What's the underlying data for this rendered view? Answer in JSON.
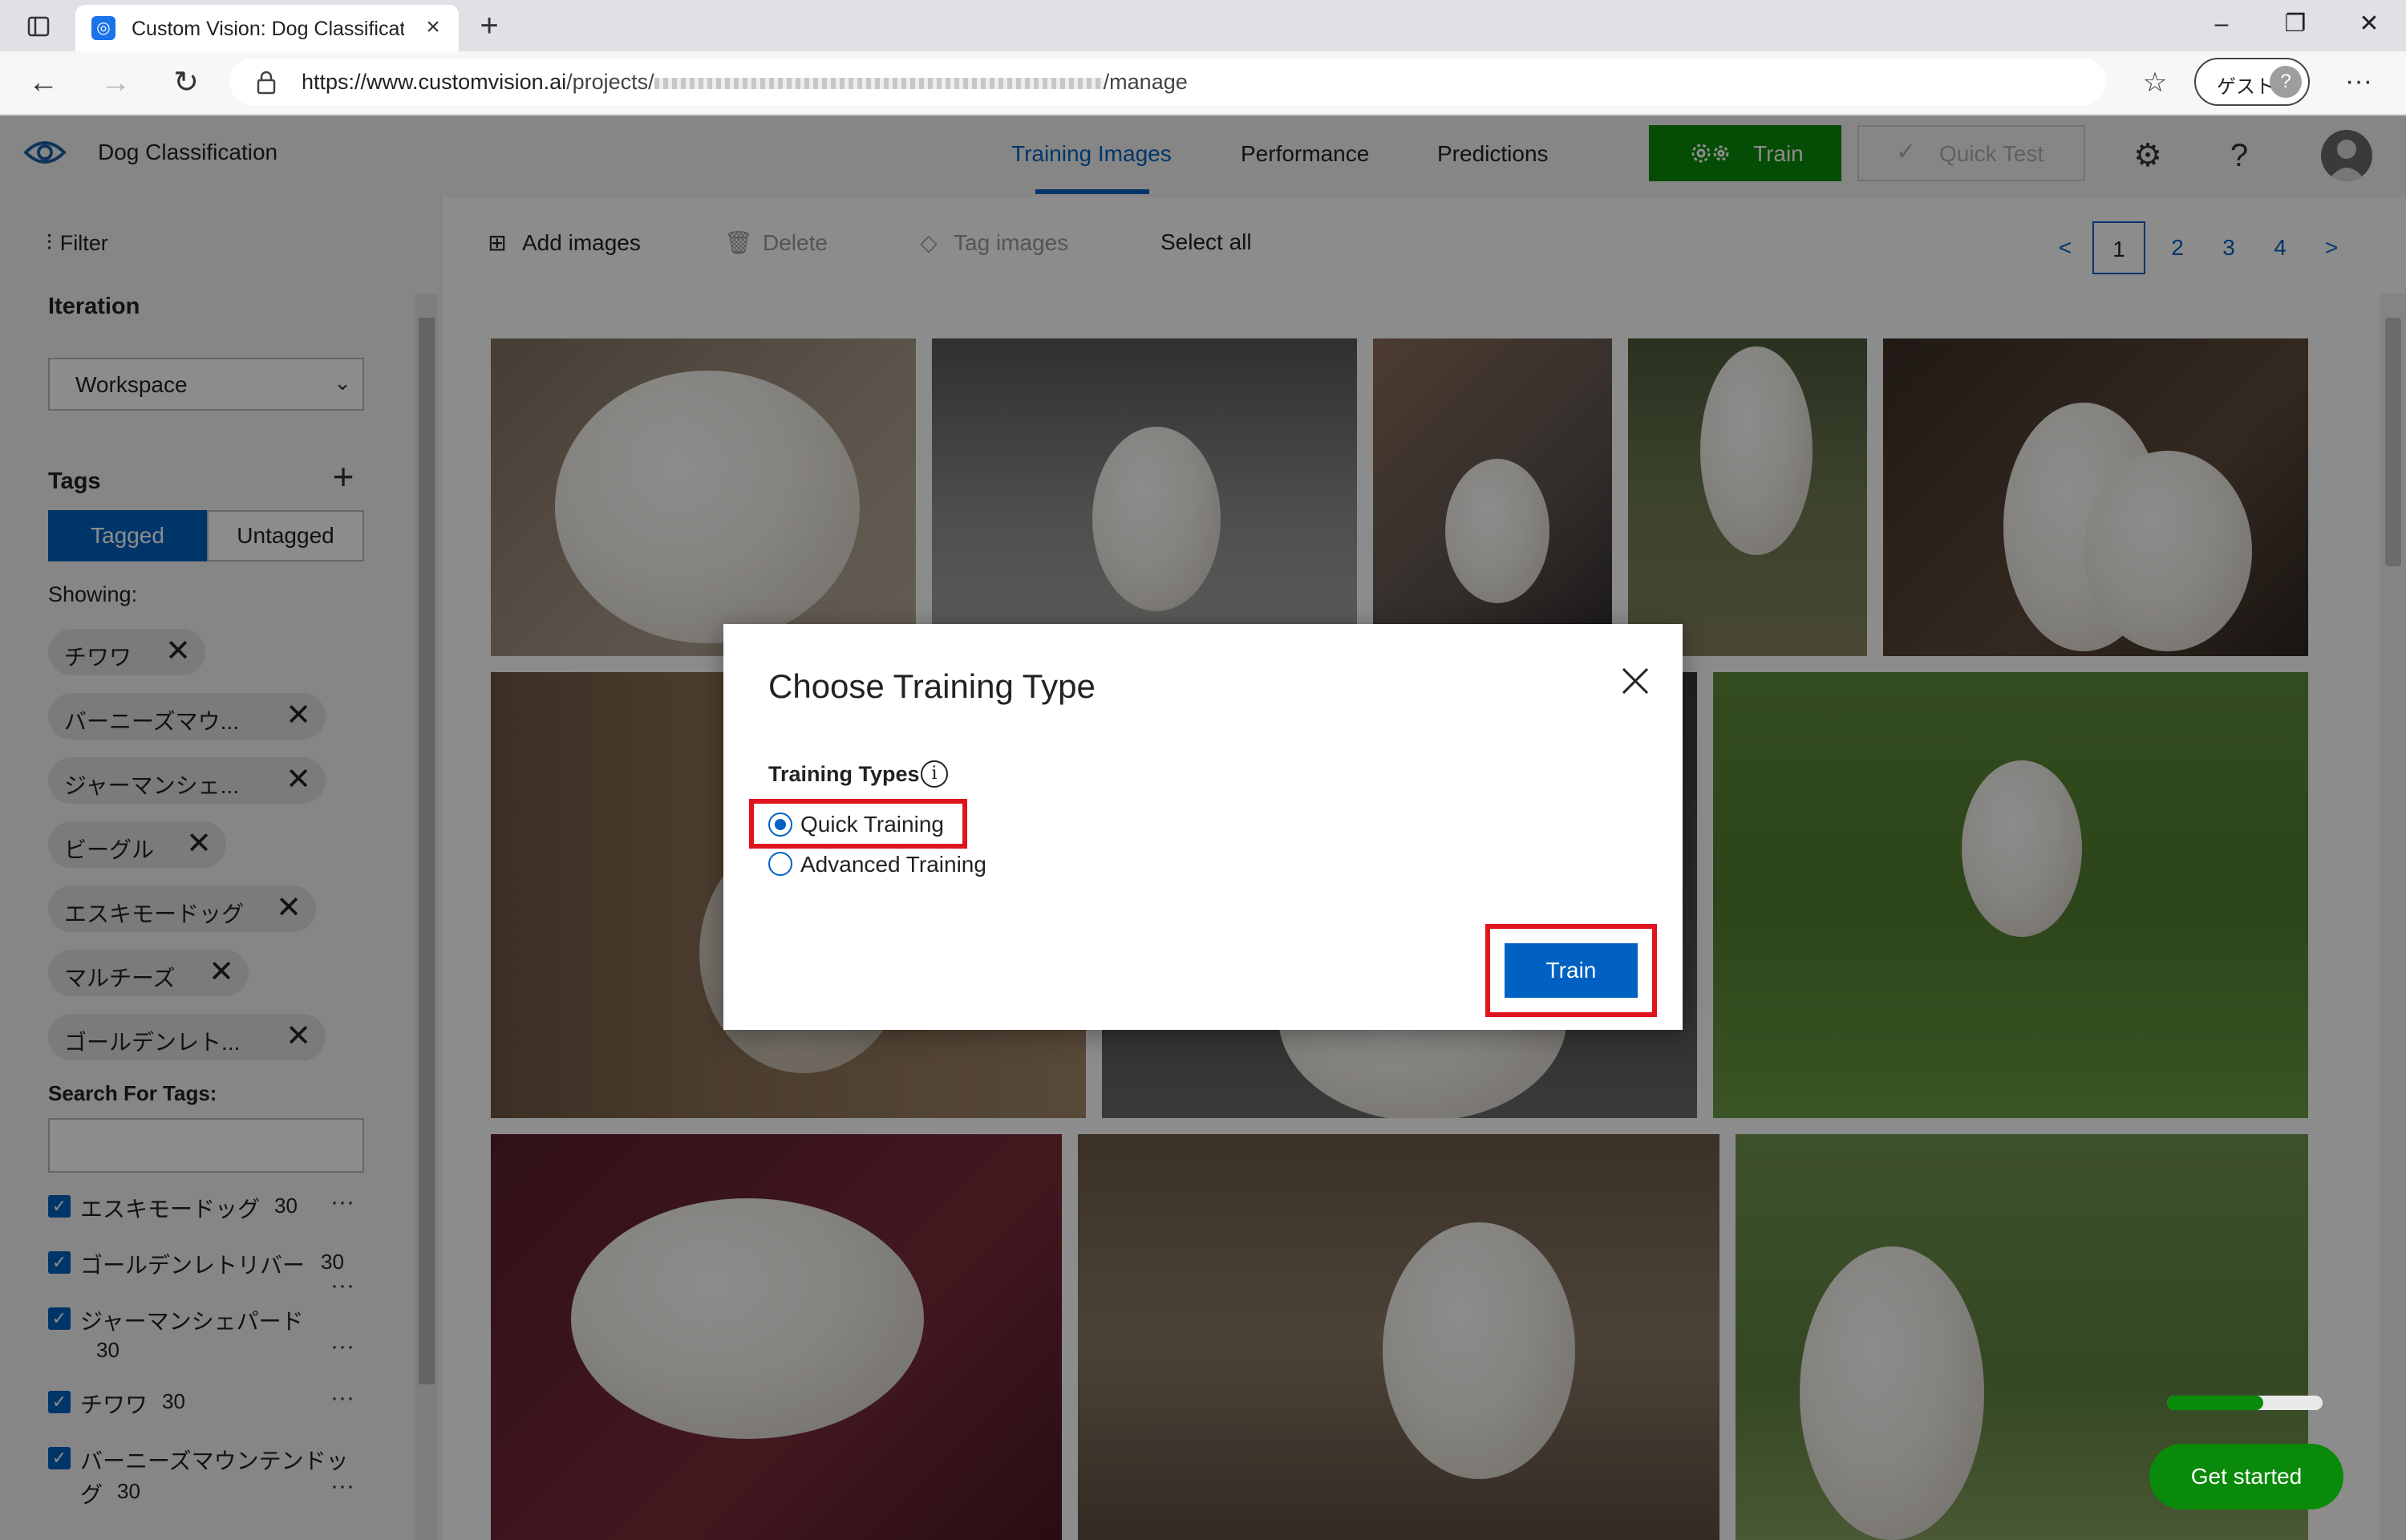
{
  "browser": {
    "tab_title": "Custom Vision: Dog Classificatio",
    "url_host": "https://www.customvision.ai",
    "url_path_start": "/projects/",
    "url_path_end": "/manage",
    "guest_label": "ゲスト"
  },
  "header": {
    "project_name": "Dog Classification",
    "tabs": [
      {
        "label": "Training Images",
        "active": true
      },
      {
        "label": "Performance",
        "active": false
      },
      {
        "label": "Predictions",
        "active": false
      }
    ],
    "train_label": "Train",
    "quick_test_label": "Quick Test"
  },
  "sidebar": {
    "filter_label": "Filter",
    "iteration_heading": "Iteration",
    "iteration_value": "Workspace",
    "tags_heading": "Tags",
    "tagged_label": "Tagged",
    "untagged_label": "Untagged",
    "showing_label": "Showing:",
    "chips": [
      "チワワ",
      "バーニーズマウ...",
      "ジャーマンシェ...",
      "ビーグル",
      "エスキモードッグ",
      "マルチーズ",
      "ゴールデンレト..."
    ],
    "search_label": "Search For Tags:",
    "tag_list": [
      {
        "name": "エスキモードッグ",
        "count": "30"
      },
      {
        "name": "ゴールデンレトリバー",
        "count": "30"
      },
      {
        "name": "ジャーマンシェパード",
        "count": "30"
      },
      {
        "name": "チワワ",
        "count": "30"
      },
      {
        "name": "バーニーズマウンテンドッ",
        "name2": "グ",
        "count": "30"
      }
    ]
  },
  "toolbar": {
    "add_images": "Add images",
    "delete": "Delete",
    "tag_images": "Tag images",
    "select_all": "Select all"
  },
  "pagination": {
    "prev": "<",
    "pages": [
      "1",
      "2",
      "3",
      "4"
    ],
    "current": "1",
    "next": ">"
  },
  "dialog": {
    "title": "Choose Training Type",
    "types_label": "Training Types",
    "info_glyph": "i",
    "options": [
      {
        "label": "Quick Training",
        "checked": true
      },
      {
        "label": "Advanced Training",
        "checked": false
      }
    ],
    "train_button": "Train"
  },
  "get_started": {
    "label": "Get started",
    "progress": 0.62
  },
  "colors": {
    "accent": "#0061c2",
    "train_green": "#0a8a0a",
    "highlight_red": "#e0141e"
  }
}
